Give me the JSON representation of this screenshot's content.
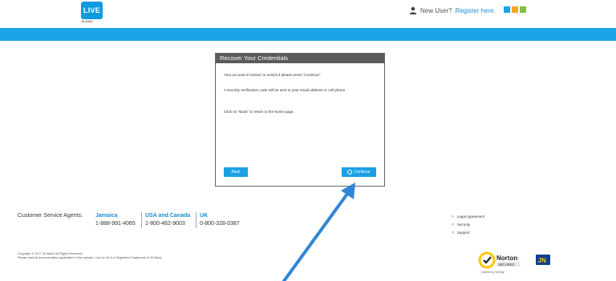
{
  "header": {
    "logo_text": "LIVE",
    "logo_sub": "JN BANK",
    "new_user_label": "New User?",
    "register_link": "Register here.",
    "squares": [
      "#1ba4e6",
      "#f5a623",
      "#7cc242"
    ]
  },
  "dialog": {
    "title": "Recover Your Credentials",
    "paragraphs": [
      "Your account is locked, to unlock it please press \"Continue\".",
      "A security verification code will be sent to your email address or cell phone.",
      "Click on \"Back\" to return to the home page."
    ],
    "back_label": "Back",
    "continue_label": "Continue"
  },
  "footer": {
    "csa_label": "Customer Service Agents:",
    "regions": [
      {
        "name": "Jamaica",
        "phone": "1-888-991-4065"
      },
      {
        "name": "USA and Canada",
        "phone": "1-800-462-9003"
      },
      {
        "name": "UK",
        "phone": "0-800-328-0387"
      }
    ],
    "links": [
      "Legal Agreement",
      "Security",
      "Support"
    ],
    "copyright": "Copyright © 2017 JN Bank. All Rights Reserved.",
    "trademark": "Please read all documentation applicable to this website. Live by JN is a Registered Trademark of JN Bank.",
    "norton_name": "Norton",
    "norton_secured": "SECURED",
    "norton_powered": "powered by VeriSign",
    "jn_logo": "JN"
  },
  "colors": {
    "brand_blue": "#1ba4e6",
    "dialog_header": "#5b5b5b",
    "arrow_blue": "#2f86d6"
  }
}
